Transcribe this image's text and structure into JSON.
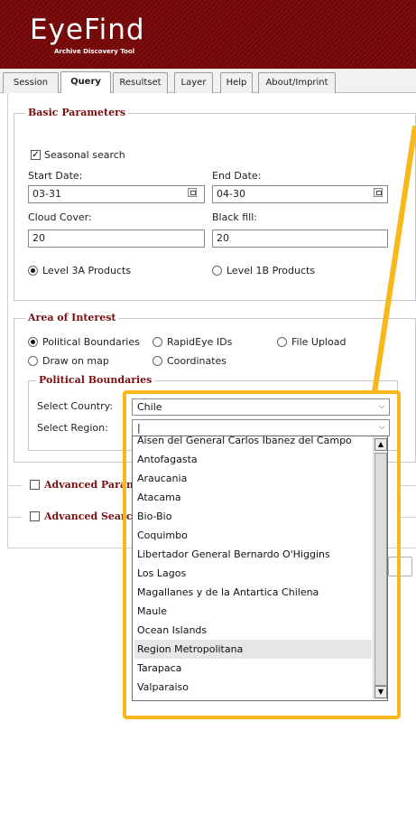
{
  "app": {
    "title": "EyeFind",
    "subtitle": "Archive Discovery Tool"
  },
  "tabs": [
    {
      "label": "Session"
    },
    {
      "label": "Query"
    },
    {
      "label": "Resultset"
    },
    {
      "label": "Layer"
    },
    {
      "label": "Help"
    },
    {
      "label": "About/Imprint"
    }
  ],
  "basic": {
    "legend": "Basic Parameters",
    "seasonal_label": "Seasonal search",
    "seasonal_checked": true,
    "start_label": "Start Date:",
    "start_value": "03-31",
    "end_label": "End Date:",
    "end_value": "04-30",
    "cloud_label": "Cloud Cover:",
    "cloud_value": "20",
    "black_label": "Black fill:",
    "black_value": "20",
    "level3a_label": "Level 3A Products",
    "level1b_label": "Level 1B Products"
  },
  "aoi": {
    "legend": "Area of Interest",
    "political_label": "Political Boundaries",
    "rapideye_label": "RapidEye IDs",
    "file_label": "File Upload",
    "draw_label": "Draw on map",
    "coords_label": "Coordinates",
    "pb_legend": "Political Boundaries",
    "country_label": "Select Country:",
    "country_value": "Chile",
    "region_label": "Select Region:",
    "region_value": "|"
  },
  "advanced": {
    "params_label": "Advanced Param",
    "search_label": "Advanced Search"
  },
  "regions": [
    "Aisen del General Carlos Ibanez del Campo",
    "Antofagasta",
    "Araucania",
    "Atacama",
    "Bio-Bio",
    "Coquimbo",
    "Libertador General Bernardo O'Higgins",
    "Los Lagos",
    "Magallanes y de la Antartica Chilena",
    "Maule",
    "Ocean Islands",
    "Region Metropolitana",
    "Tarapaca",
    "Valparaiso"
  ],
  "selected_region": "Region Metropolitana",
  "colors": {
    "header": "#7e0e0e",
    "legend_text": "#7a1010",
    "highlight": "#f6b81b"
  },
  "icons": {
    "calendar": "calendar-icon",
    "dropdown": "chevron-down-icon",
    "scroll_up": "scroll-up-arrow-icon",
    "scroll_down": "scroll-down-arrow-icon"
  }
}
